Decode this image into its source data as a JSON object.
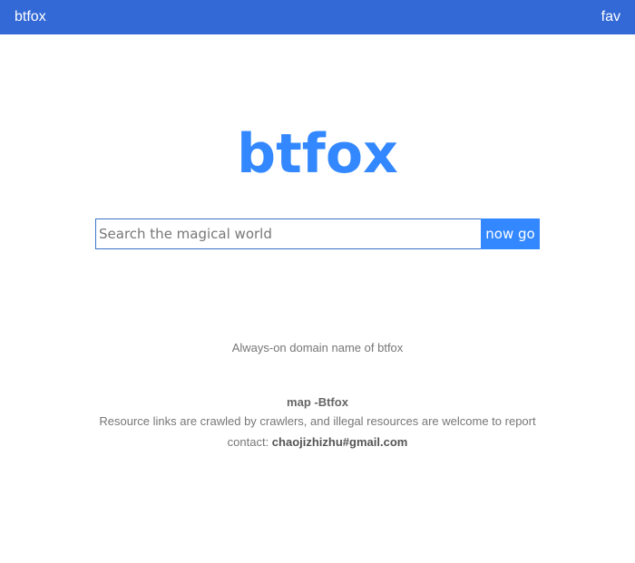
{
  "header": {
    "brand": "btfox",
    "fav": "fav"
  },
  "logo": "btfox",
  "search": {
    "placeholder": "Search the magical world",
    "button": "now go"
  },
  "tagline": "Always-on domain name of btfox",
  "footer": {
    "map_link": "map -Btfox",
    "notice": "Resource links are crawled by crawlers, and illegal resources are welcome to report",
    "contact_label": "contact: ",
    "email": "chaojizhizhu#gmail.com"
  },
  "colors": {
    "header_bg": "#3369d6",
    "accent": "#3388ff"
  }
}
